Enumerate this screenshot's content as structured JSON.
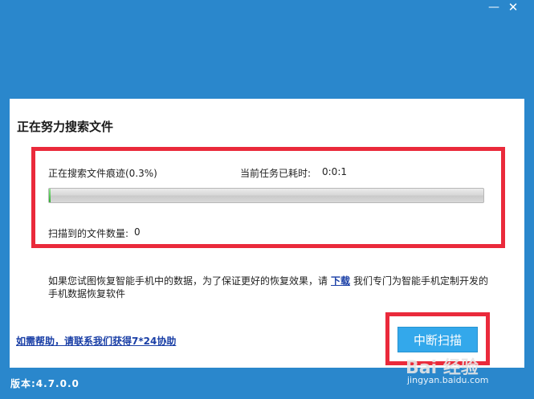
{
  "window": {
    "minimize_icon": "minus-icon",
    "close_icon": "close-icon",
    "minimize_glyph": "—",
    "close_glyph": "✕"
  },
  "panel": {
    "heading": "正在努力搜索文件",
    "scan": {
      "status_label": "正在搜索文件痕迹(0.3%)",
      "elapsed_label": "当前任务已耗时:",
      "elapsed_value": "0:0:1",
      "progress_percent": 0.3,
      "found_label": "扫描到的文件数量:",
      "found_value": "0"
    },
    "info": {
      "text_before": "如果您试图恢复智能手机中的数据，为了保证更好的恢复效果，请",
      "link_text": "下载",
      "text_after": "我们专门为智能手机定制开发的手机数据恢复软件"
    },
    "help_link": "如需帮助，请联系我们获得7*24协助",
    "pause_button": "中断扫描"
  },
  "footer": {
    "version": "版本:4.7.0.0"
  },
  "watermark": {
    "mark": "Bai 经验",
    "url": "jingyan.baidu.com"
  },
  "colors": {
    "background": "#2a87cc",
    "highlight": "#ea2a3b",
    "button": "#33a8eb",
    "link": "#1a3fa6"
  }
}
